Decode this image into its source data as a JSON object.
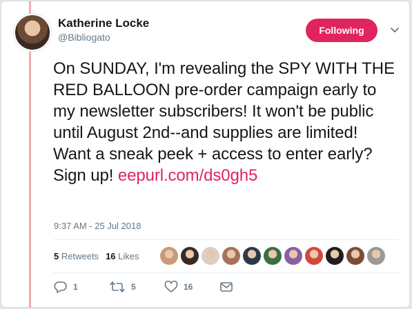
{
  "user": {
    "name": "Katherine Locke",
    "handle": "@Bibliogato",
    "follow_label": "Following"
  },
  "tweet": {
    "text": "On SUNDAY, I'm revealing the SPY WITH THE RED BALLOON pre-order campaign early to my newsletter subscribers! It won't be public until August 2nd--and supplies are limited! Want a sneak peek + access to enter early? Sign up! ",
    "link": "eepurl.com/ds0gh5",
    "timestamp": "9:37 AM - 25 Jul 2018"
  },
  "stats": {
    "retweets_count": "5",
    "retweets_label": "Retweets",
    "likes_count": "16",
    "likes_label": "Likes"
  },
  "liker_avatars": [
    {
      "color": "#c89a7a"
    },
    {
      "color": "#3b2a22"
    },
    {
      "color": "#d9cfc2"
    },
    {
      "color": "#a5735a"
    },
    {
      "color": "#2b3a4a"
    },
    {
      "color": "#3a6f45"
    },
    {
      "color": "#8a5fa0"
    },
    {
      "color": "#d04a3c"
    },
    {
      "color": "#1f1f1f"
    },
    {
      "color": "#7a4e36"
    },
    {
      "color": "#9a9a9a"
    }
  ],
  "actions": {
    "reply_count": "1",
    "retweet_count": "5",
    "like_count": "16"
  },
  "colors": {
    "accent": "#e0245e",
    "thread": "#f4a9b0",
    "muted": "#657786"
  }
}
